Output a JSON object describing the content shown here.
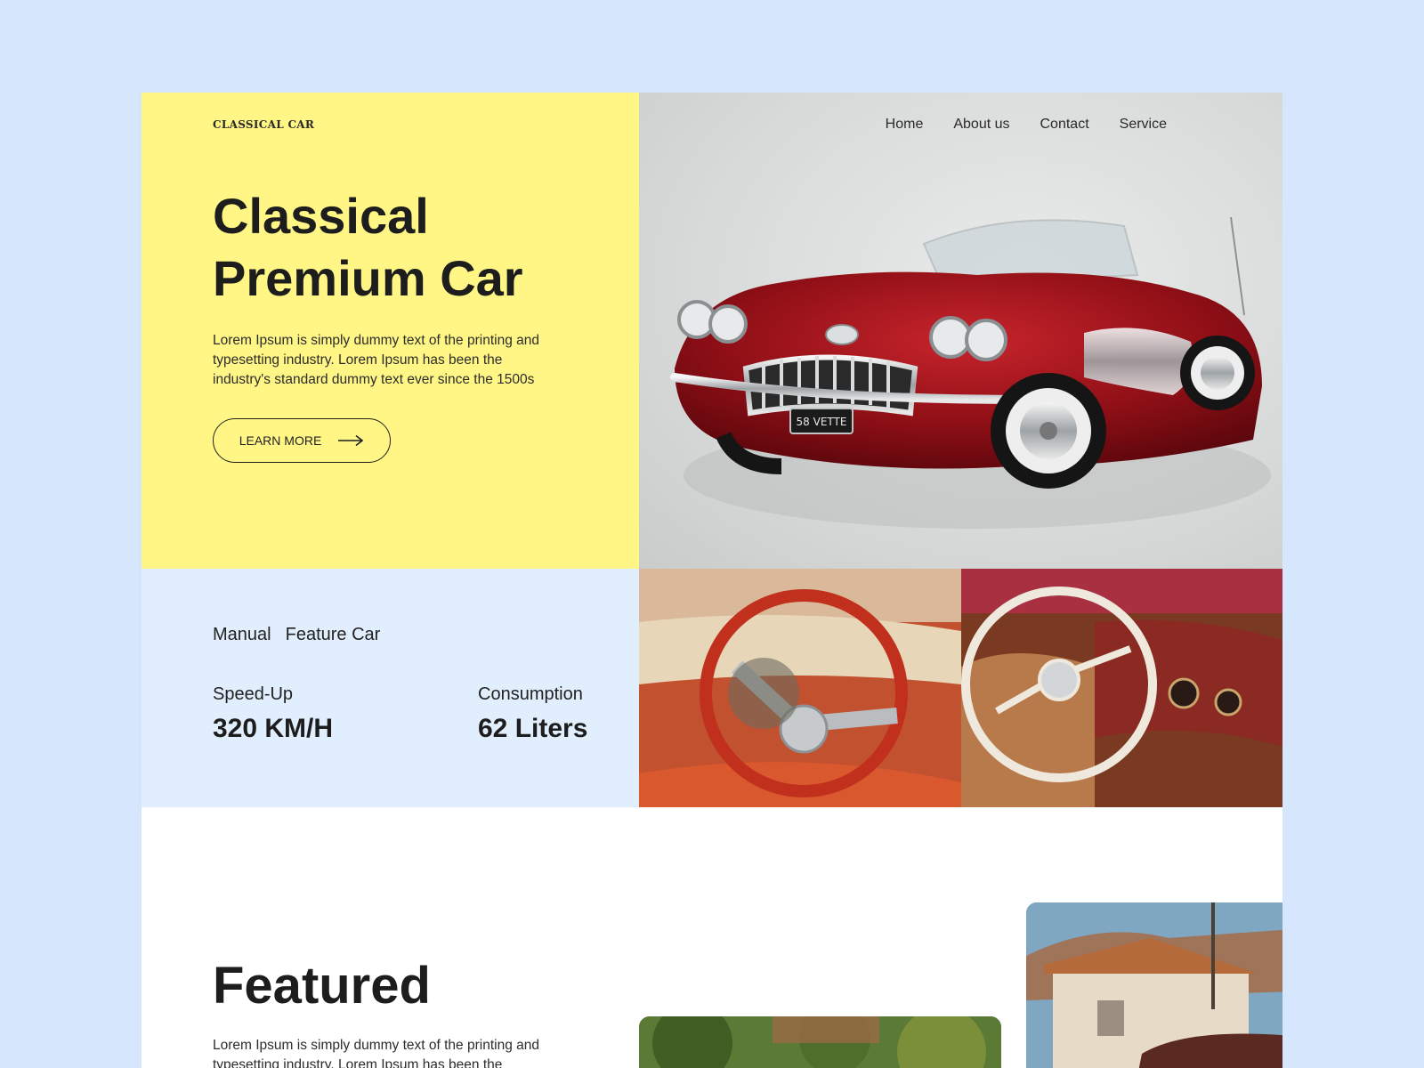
{
  "brand": {
    "logo": "CLASSICAL CAR"
  },
  "nav": {
    "items": [
      {
        "label": "Home"
      },
      {
        "label": "About us"
      },
      {
        "label": "Contact"
      },
      {
        "label": "Service"
      }
    ]
  },
  "hero": {
    "title_line1": "Classical",
    "title_line2": "Premium Car",
    "description": "Lorem Ipsum is simply dummy text of the printing and typesetting industry. Lorem Ipsum has been the industry's standard dummy text ever since the 1500s",
    "cta_label": "LEARN MORE",
    "cta_icon": "arrow-right-icon",
    "image_plate": "58 VETTE"
  },
  "features": {
    "tabs": [
      {
        "label": "Manual"
      },
      {
        "label": "Feature Car"
      }
    ],
    "speed": {
      "label": "Speed-Up",
      "value": "320 KM/H"
    },
    "consumption": {
      "label": "Consumption",
      "value": "62 Liters"
    }
  },
  "featured": {
    "title": "Featured",
    "description": "Lorem Ipsum is simply dummy text of the printing and typesetting industry. Lorem Ipsum has been the"
  },
  "colors": {
    "page_bg": "#d6e6fd",
    "hero_bg": "#fff685",
    "features_bg": "#e1eefe",
    "car_red": "#a3121a"
  }
}
